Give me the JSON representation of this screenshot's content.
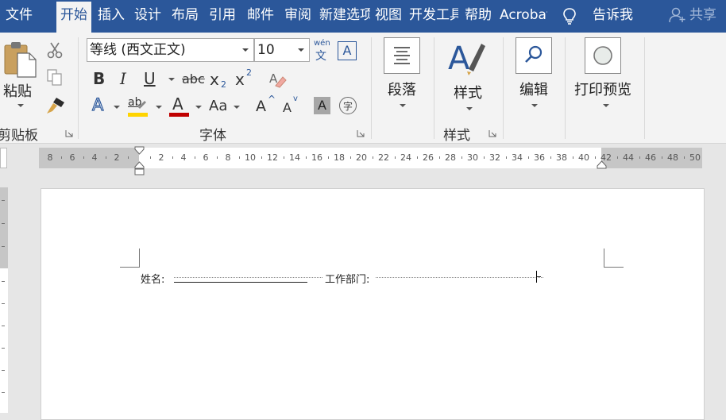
{
  "tabs": [
    {
      "label": "文件",
      "active": false
    },
    {
      "label": "开始",
      "active": true
    },
    {
      "label": "插入",
      "active": false
    },
    {
      "label": "设计",
      "active": false
    },
    {
      "label": "布局",
      "active": false
    },
    {
      "label": "引用",
      "active": false
    },
    {
      "label": "邮件",
      "active": false
    },
    {
      "label": "审阅",
      "active": false
    },
    {
      "label": "新建选项卡",
      "active": false
    },
    {
      "label": "视图",
      "active": false
    },
    {
      "label": "开发工具",
      "active": false
    },
    {
      "label": "帮助",
      "active": false
    },
    {
      "label": "Acrobat",
      "active": false
    }
  ],
  "tell_me": "告诉我",
  "share": "共享",
  "colors": {
    "tabbar": "#2b579a",
    "ribbon": "#f3f3f3",
    "highlight": "#ffd400",
    "font_color": "#c00000",
    "accent": "#2b579a"
  },
  "ribbon": {
    "clipboard": {
      "paste_label": "粘贴",
      "group_label": "剪贴板",
      "icons": [
        "paste-icon",
        "cut-icon",
        "copy-icon",
        "format-painter-icon"
      ]
    },
    "font": {
      "font_name": "等线 (西文正文)",
      "font_size": "10",
      "phonetic_top": "wén",
      "phonetic_bottom": "文",
      "char_border": "A",
      "bold": "B",
      "italic": "I",
      "underline": "U",
      "strikethrough": "abc",
      "subscript_base": "x",
      "subscript": "2",
      "superscript_base": "x",
      "superscript": "2",
      "text_effects": "A",
      "highlight": "ab",
      "font_color": "A",
      "change_case": "Aa",
      "grow": "A",
      "grow_mark": "^",
      "shrink": "A",
      "shrink_mark": "v",
      "shading": "A",
      "enclose": "字",
      "group_label": "字体"
    },
    "paragraph": {
      "label": "段落"
    },
    "styles": {
      "label": "样式",
      "group_label": "样式"
    },
    "editing": {
      "label": "编辑"
    },
    "print_preview": {
      "label": "打印预览"
    }
  },
  "ruler": {
    "left_numbers": [
      "8",
      "6",
      "4",
      "2"
    ],
    "right_numbers": [
      "2",
      "4",
      "6",
      "8",
      "10",
      "12",
      "14",
      "16",
      "18",
      "20",
      "22",
      "24",
      "26",
      "28",
      "30",
      "32",
      "34",
      "36",
      "38",
      "40"
    ],
    "margin_numbers": [
      "42",
      "44",
      "46",
      "48",
      "50"
    ]
  },
  "document": {
    "name_label": "姓名:",
    "department_label": "工作部门:"
  }
}
